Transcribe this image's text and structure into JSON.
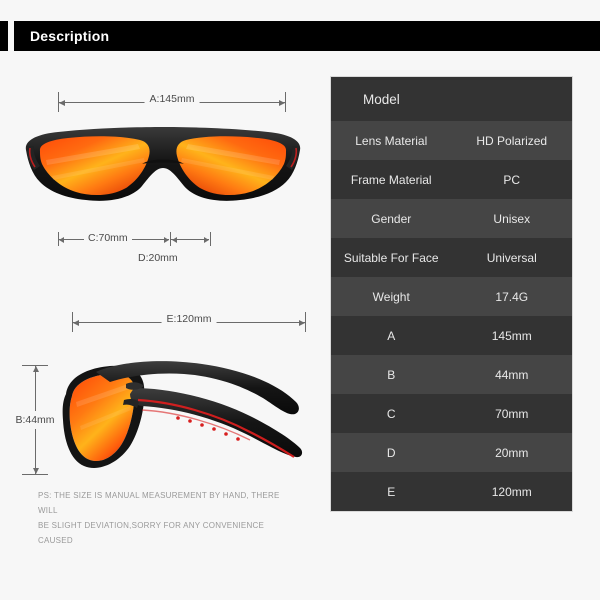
{
  "header": {
    "title": "Description"
  },
  "diagrams": {
    "front": {
      "name": "front-view",
      "width_dim": "A:145mm",
      "lens_dim": "C:70mm",
      "bridge_dim": "D:20mm"
    },
    "side": {
      "name": "side-view",
      "length_dim": "E:120mm",
      "height_dim": "B:44mm"
    }
  },
  "footnote": {
    "line1": "PS: THE SIZE IS MANUAL MEASUREMENT BY HAND, THERE WILL",
    "line2": "BE SLIGHT DEVIATION,SORRY FOR ANY CONVENIENCE CAUSED"
  },
  "spec_table": {
    "title": "Model",
    "rows": [
      {
        "key": "Lens Material",
        "value": "HD Polarized"
      },
      {
        "key": "Frame Material",
        "value": "PC"
      },
      {
        "key": "Gender",
        "value": "Unisex"
      },
      {
        "key": "Suitable For Face",
        "value": "Universal"
      },
      {
        "key": "Weight",
        "value": "17.4G"
      },
      {
        "key": "A",
        "value": "145mm"
      },
      {
        "key": "B",
        "value": "44mm"
      },
      {
        "key": "C",
        "value": "70mm"
      },
      {
        "key": "D",
        "value": "20mm"
      },
      {
        "key": "E",
        "value": "120mm"
      }
    ]
  },
  "colors": {
    "page_background": "#f7f7f7",
    "header_bar": "#000000",
    "header_text": "#ffffff",
    "row_dark": "#333333",
    "row_light": "#454545",
    "row_text": "#e8e8e8",
    "dimension_line": "#6b6b6b",
    "dimension_text": "#4a4a4a",
    "footnote_text": "#9a9a9a",
    "frame_black": "#1a1a1a",
    "lens_orange": "#ff5a10",
    "lens_yellow": "#ffc21a",
    "accent_red": "#d81f1f"
  }
}
